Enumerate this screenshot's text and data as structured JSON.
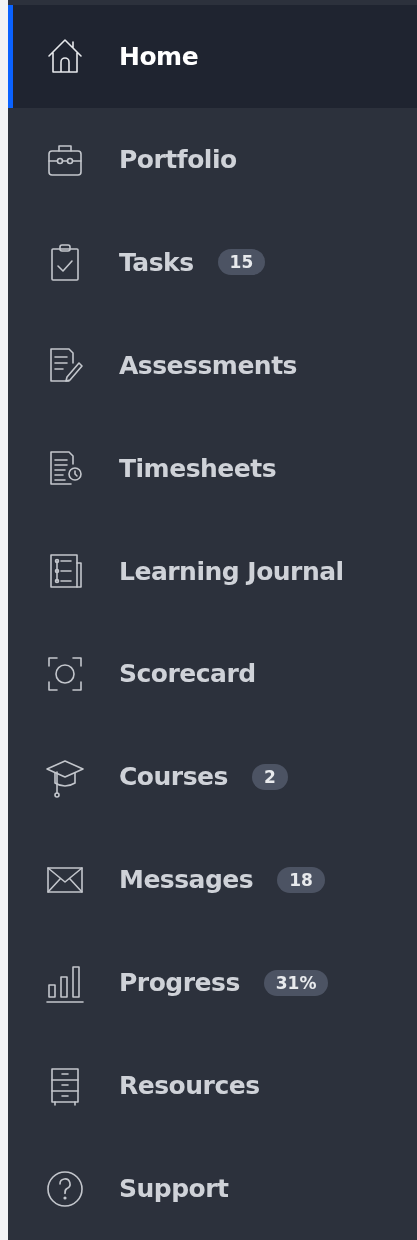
{
  "sidebar": {
    "items": [
      {
        "label": "Home",
        "selected": true
      },
      {
        "label": "Portfolio",
        "selected": false
      },
      {
        "label": "Tasks",
        "selected": false,
        "badge": "15"
      },
      {
        "label": "Assessments",
        "selected": false
      },
      {
        "label": "Timesheets",
        "selected": false
      },
      {
        "label": "Learning Journal",
        "selected": false
      },
      {
        "label": "Scorecard",
        "selected": false
      },
      {
        "label": "Courses",
        "selected": false,
        "badge": "2"
      },
      {
        "label": "Messages",
        "selected": false,
        "badge": "18"
      },
      {
        "label": "Progress",
        "selected": false,
        "badge": "31%"
      },
      {
        "label": "Resources",
        "selected": false
      },
      {
        "label": "Support",
        "selected": false
      }
    ]
  }
}
